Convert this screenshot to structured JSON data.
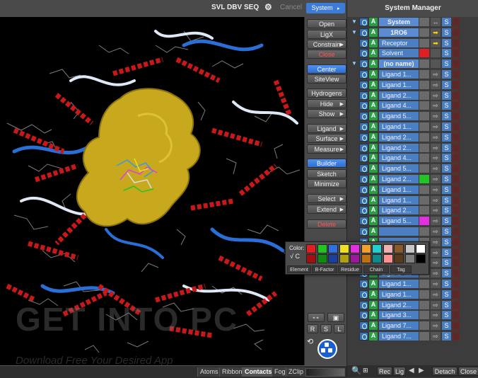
{
  "toolbar": {
    "svl": "SVL",
    "dbv": "DBV",
    "seq": "SEQ",
    "cancel": "Cancel",
    "system": "System"
  },
  "commands": {
    "open": "Open",
    "ligx": "LigX",
    "constrain": "Constrain",
    "close": "Close",
    "center": "Center",
    "siteview": "SiteView",
    "hydrogens": "Hydrogens",
    "hide": "Hide",
    "show": "Show",
    "ligand": "Ligand",
    "surface": "Surface",
    "measure": "Measure",
    "builder": "Builder",
    "sketch": "Sketch",
    "minimize": "Minimize",
    "select": "Select",
    "extend": "Extend",
    "delete": "Delete",
    "r": "R",
    "s": "S",
    "l": "L"
  },
  "bottom_bar": {
    "atoms": "Atoms",
    "ribbon": "Ribbon",
    "contacts": "Contacts",
    "fog": "Fog",
    "zclip": "ZClip"
  },
  "watermark": {
    "main": "GET INTO PC",
    "sub": "Download Free Your Desired App"
  },
  "system_manager": {
    "title": "System Manager",
    "rows": [
      {
        "name": "System",
        "tri": "▼",
        "bold": true,
        "vis": "↔"
      },
      {
        "name": "1RO6",
        "tri": "▼",
        "bold": true,
        "vis": "➡",
        "yellow": true
      },
      {
        "name": "Receptor",
        "tri": "",
        "bold": false,
        "vis": "➡",
        "yellow": true
      },
      {
        "name": "Solvent",
        "tri": "",
        "bold": false,
        "vis": "",
        "color": "#e02020"
      },
      {
        "name": "(no name)",
        "tri": "▼",
        "bold": true,
        "vis": ""
      },
      {
        "name": "Ligand 1...",
        "vis": "⇨"
      },
      {
        "name": "Ligand 1...",
        "vis": "⇨"
      },
      {
        "name": "Ligand 2...",
        "vis": "⇨"
      },
      {
        "name": "Ligand 4...",
        "vis": "⇨"
      },
      {
        "name": "Ligand 5...",
        "vis": "⇨"
      },
      {
        "name": "Ligand 1...",
        "vis": "⇨"
      },
      {
        "name": "Ligand 2...",
        "vis": "⇨"
      },
      {
        "name": "Ligand 2...",
        "vis": "⇨"
      },
      {
        "name": "Ligand 4...",
        "vis": "⇨"
      },
      {
        "name": "Ligand 5...",
        "vis": "⇨"
      },
      {
        "name": "Ligand 2...",
        "vis": "⇨",
        "color": "#22c522"
      },
      {
        "name": "Ligand 1...",
        "vis": "⇨"
      },
      {
        "name": "Ligand 1...",
        "vis": "⇨"
      },
      {
        "name": "Ligand 2...",
        "vis": "⇨"
      },
      {
        "name": "Ligand 5...",
        "vis": "⇨",
        "color": "#e030e0"
      },
      {
        "name": "",
        "vis": "⇨"
      },
      {
        "name": "",
        "vis": "⇨"
      },
      {
        "name": "",
        "vis": "⇨"
      },
      {
        "name": "Ligand 2...",
        "vis": "⇨"
      },
      {
        "name": "Ligand 4...",
        "vis": "⇨"
      },
      {
        "name": "Ligand 1...",
        "vis": "⇨"
      },
      {
        "name": "Ligand 1...",
        "vis": "⇨"
      },
      {
        "name": "Ligand 2...",
        "vis": "⇨"
      },
      {
        "name": "Ligand 3...",
        "vis": "⇨"
      },
      {
        "name": "Ligand 7...",
        "vis": "⇨"
      },
      {
        "name": "Ligand 7...",
        "vis": "⇨"
      }
    ],
    "bottom": {
      "rec": "Rec",
      "lig": "Lig",
      "detach": "Detach",
      "close": "Close"
    }
  },
  "color_popup": {
    "label": "Color:",
    "check": "√ C",
    "tabs": [
      "Element",
      "B-Factor",
      "Residue",
      "Chain",
      "Tag"
    ],
    "swatches_top": [
      "#e02020",
      "#22c522",
      "#2f6fe0",
      "#f0e020",
      "#e030e0",
      "#f0a030",
      "#20d0d0",
      "#f0b0b0",
      "#8b5a2b",
      "#c8c8c8",
      "#ffffff"
    ],
    "swatches_bottom": [
      "#a01010",
      "#108a10",
      "#1a3fa0",
      "#b0a010",
      "#9a189a",
      "#c07010",
      "#108a8a",
      "#ff9090",
      "#5a3a1a",
      "#808080",
      "#000000"
    ]
  }
}
